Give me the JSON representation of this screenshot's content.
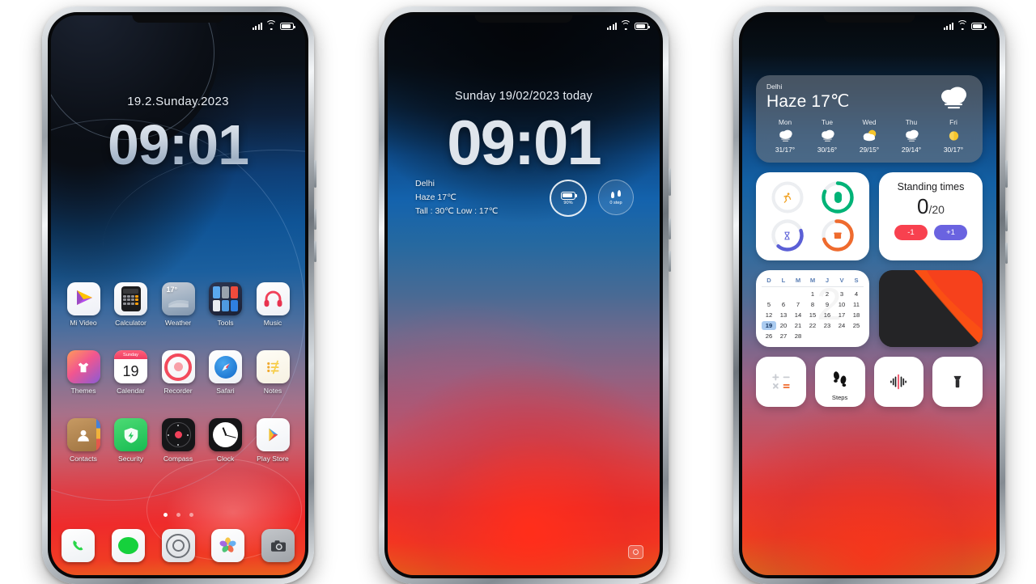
{
  "phones": [
    {
      "name": "home-screen-phone",
      "statusbar": {
        "signal": "signal-bars-icon",
        "wifi": "wifi-icon",
        "battery": "battery-icon"
      },
      "lockscreen": {
        "date": "19.2.Sunday.2023",
        "time": "09:01"
      },
      "apps_rows": [
        [
          {
            "label": "Mi Video",
            "icon": "mi-video-icon"
          },
          {
            "label": "Calculator",
            "icon": "calculator-icon"
          },
          {
            "label": "Weather",
            "icon": "weather-icon",
            "badge": "17°"
          },
          {
            "label": "Tools",
            "icon": "tools-folder-icon"
          },
          {
            "label": "Music",
            "icon": "music-headphones-icon"
          }
        ],
        [
          {
            "label": "Themes",
            "icon": "themes-tshirt-icon"
          },
          {
            "label": "Calendar",
            "icon": "calendar-icon",
            "badge": "19",
            "sub": "Sunday"
          },
          {
            "label": "Recorder",
            "icon": "recorder-icon"
          },
          {
            "label": "Safari",
            "icon": "safari-compass-icon"
          },
          {
            "label": "Notes",
            "icon": "notes-icon"
          }
        ],
        [
          {
            "label": "Contacts",
            "icon": "contacts-icon"
          },
          {
            "label": "Security",
            "icon": "security-shield-icon"
          },
          {
            "label": "Compass",
            "icon": "compass-icon"
          },
          {
            "label": "Clock",
            "icon": "clock-icon"
          },
          {
            "label": "Play Store",
            "icon": "play-store-icon"
          }
        ]
      ],
      "dock": [
        {
          "label": "Phone",
          "icon": "phone-handset-icon"
        },
        {
          "label": "Messages",
          "icon": "messages-bubble-icon"
        },
        {
          "label": "Settings",
          "icon": "settings-gear-icon"
        },
        {
          "label": "Photos",
          "icon": "photos-flower-icon"
        },
        {
          "label": "Camera",
          "icon": "camera-icon"
        }
      ],
      "page_dots": {
        "count": 3,
        "active": 1
      }
    },
    {
      "name": "lock-screen-phone",
      "lockscreen": {
        "date": "Sunday 19/02/2023 today",
        "time": "09:01",
        "city": "Delhi",
        "condition": "Haze 17℃",
        "highlow": "Tall : 30℃  Low : 17℃",
        "battery_percent": "90%",
        "steps": "0 step"
      },
      "camera_shortcut": "camera-icon"
    },
    {
      "name": "widget-screen-phone",
      "weather": {
        "city": "Delhi",
        "condition": "Haze 17℃",
        "icon": "haze-cloud-icon",
        "forecast": [
          {
            "day": "Mon",
            "icon": "haze-cloud-icon",
            "temps": "31/17°"
          },
          {
            "day": "Tue",
            "icon": "haze-cloud-icon",
            "temps": "30/16°"
          },
          {
            "day": "Wed",
            "icon": "partly-sunny-icon",
            "temps": "29/15°"
          },
          {
            "day": "Thu",
            "icon": "haze-cloud-icon",
            "temps": "29/14°"
          },
          {
            "day": "Fri",
            "icon": "sunny-icon",
            "temps": "30/17°"
          }
        ]
      },
      "activity_rings": [
        {
          "name": "move-ring",
          "icon": "running-person-icon",
          "color": "#f0a020",
          "progress": 0
        },
        {
          "name": "exercise-ring",
          "icon": "capsule-icon",
          "color": "#00b377",
          "progress": 82
        },
        {
          "name": "stand-ring",
          "icon": "hourglass-icon",
          "color": "#5b5fd6",
          "progress": 40
        },
        {
          "name": "calories-ring",
          "icon": "box-icon",
          "color": "#ef6b2e",
          "progress": 72
        }
      ],
      "standing": {
        "title": "Standing times",
        "value": "0",
        "goal": "/20",
        "minus_label": "-1",
        "plus_label": "+1",
        "minus_color": "#f8414f",
        "plus_color": "#6a63e0"
      },
      "calendar": {
        "headers": [
          "D",
          "L",
          "M",
          "M",
          "J",
          "V",
          "S"
        ],
        "ghost": "2",
        "leading_blanks": 3,
        "days": [
          1,
          2,
          3,
          4,
          5,
          6,
          7,
          8,
          9,
          10,
          11,
          12,
          13,
          14,
          15,
          16,
          17,
          18,
          19,
          20,
          21,
          22,
          23,
          24,
          25,
          26,
          27,
          28
        ],
        "today": 19,
        "today_color": "#aacbf0"
      },
      "dark_widget": {
        "name": "abstract-dark-orange-widget",
        "dark": "#242426",
        "accent": "#f6411c"
      },
      "shortcuts": [
        {
          "label": "",
          "icon": "calculator-symbols-icon"
        },
        {
          "label": "Steps",
          "icon": "footsteps-icon"
        },
        {
          "label": "",
          "icon": "voice-waveform-icon"
        },
        {
          "label": "",
          "icon": "flashlight-icon"
        }
      ]
    }
  ]
}
